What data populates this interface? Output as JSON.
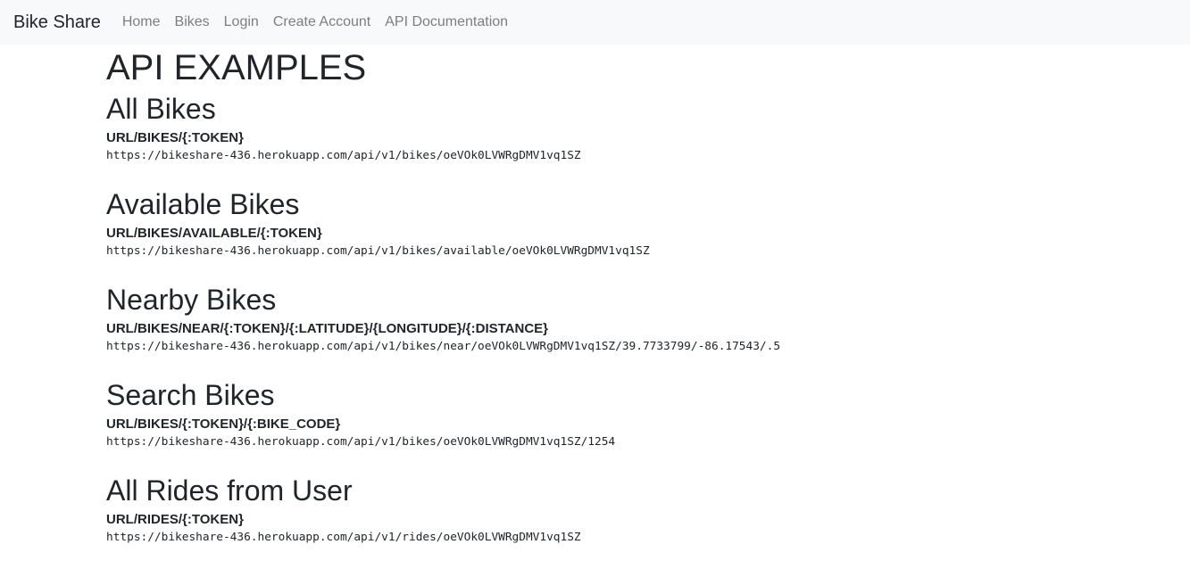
{
  "navbar": {
    "brand": "Bike Share",
    "links": [
      "Home",
      "Bikes",
      "Login",
      "Create Account",
      "API Documentation"
    ]
  },
  "page_title": "API EXAMPLES",
  "sections": [
    {
      "title": "All Bikes",
      "pattern": "URL/BIKES/{:TOKEN}",
      "example": "https://bikeshare-436.herokuapp.com/api/v1/bikes/oeVOk0LVWRgDMV1vq1SZ"
    },
    {
      "title": "Available Bikes",
      "pattern": "URL/BIKES/AVAILABLE/{:TOKEN}",
      "example": "https://bikeshare-436.herokuapp.com/api/v1/bikes/available/oeVOk0LVWRgDMV1vq1SZ"
    },
    {
      "title": "Nearby Bikes",
      "pattern": "URL/BIKES/NEAR/{:TOKEN}/{:LATITUDE}/{LONGITUDE}/{:DISTANCE}",
      "example": "https://bikeshare-436.herokuapp.com/api/v1/bikes/near/oeVOk0LVWRgDMV1vq1SZ/39.7733799/-86.17543/.5"
    },
    {
      "title": "Search Bikes",
      "pattern": "URL/BIKES/{:TOKEN}/{:BIKE_CODE}",
      "example": "https://bikeshare-436.herokuapp.com/api/v1/bikes/oeVOk0LVWRgDMV1vq1SZ/1254"
    },
    {
      "title": "All Rides from User",
      "pattern": "URL/RIDES/{:TOKEN}",
      "example": "https://bikeshare-436.herokuapp.com/api/v1/rides/oeVOk0LVWRgDMV1vq1SZ"
    }
  ]
}
